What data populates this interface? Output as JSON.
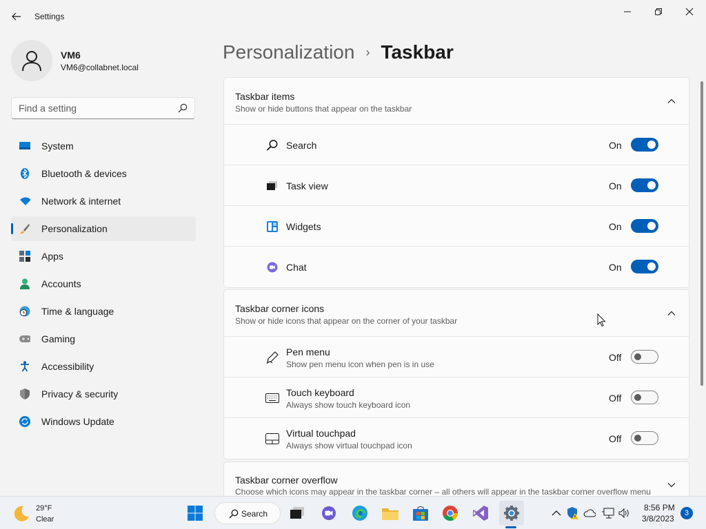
{
  "window": {
    "title": "Settings"
  },
  "profile": {
    "name": "VM6",
    "email": "VM6@collabnet.local"
  },
  "search": {
    "placeholder": "Find a setting"
  },
  "nav": [
    {
      "label": "System",
      "icon": "monitor-icon"
    },
    {
      "label": "Bluetooth & devices",
      "icon": "bluetooth-icon"
    },
    {
      "label": "Network & internet",
      "icon": "wifi-icon"
    },
    {
      "label": "Personalization",
      "icon": "brush-icon",
      "active": true
    },
    {
      "label": "Apps",
      "icon": "apps-icon"
    },
    {
      "label": "Accounts",
      "icon": "person-icon"
    },
    {
      "label": "Time & language",
      "icon": "clock-globe-icon"
    },
    {
      "label": "Gaming",
      "icon": "gamepad-icon"
    },
    {
      "label": "Accessibility",
      "icon": "accessibility-icon"
    },
    {
      "label": "Privacy & security",
      "icon": "shield-icon"
    },
    {
      "label": "Windows Update",
      "icon": "update-icon"
    }
  ],
  "breadcrumb": {
    "parent": "Personalization",
    "separator": "›",
    "current": "Taskbar"
  },
  "sections": {
    "taskbar_items": {
      "title": "Taskbar items",
      "subtitle": "Show or hide buttons that appear on the taskbar",
      "rows": [
        {
          "label": "Search",
          "state": "On",
          "icon": "search-icon"
        },
        {
          "label": "Task view",
          "state": "On",
          "icon": "task-view-icon"
        },
        {
          "label": "Widgets",
          "state": "On",
          "icon": "widgets-icon"
        },
        {
          "label": "Chat",
          "state": "On",
          "icon": "chat-icon"
        }
      ]
    },
    "corner_icons": {
      "title": "Taskbar corner icons",
      "subtitle": "Show or hide icons that appear on the corner of your taskbar",
      "rows": [
        {
          "label": "Pen menu",
          "sub": "Show pen menu icon when pen is in use",
          "state": "Off",
          "icon": "pen-icon"
        },
        {
          "label": "Touch keyboard",
          "sub": "Always show touch keyboard icon",
          "state": "Off",
          "icon": "keyboard-icon"
        },
        {
          "label": "Virtual touchpad",
          "sub": "Always show virtual touchpad icon",
          "state": "Off",
          "icon": "touchpad-icon"
        }
      ]
    },
    "corner_overflow": {
      "title": "Taskbar corner overflow",
      "subtitle": "Choose which icons may appear in the taskbar corner – all others will appear in the taskbar corner overflow menu"
    }
  },
  "taskbar": {
    "weather": {
      "temp": "29°F",
      "condition": "Clear"
    },
    "search_label": "Search",
    "time": "8:56 PM",
    "date": "3/8/2023",
    "notifications": "3"
  },
  "colors": {
    "accent": "#005fb8",
    "background": "#f3f3f3",
    "card": "#fbfbfb"
  }
}
